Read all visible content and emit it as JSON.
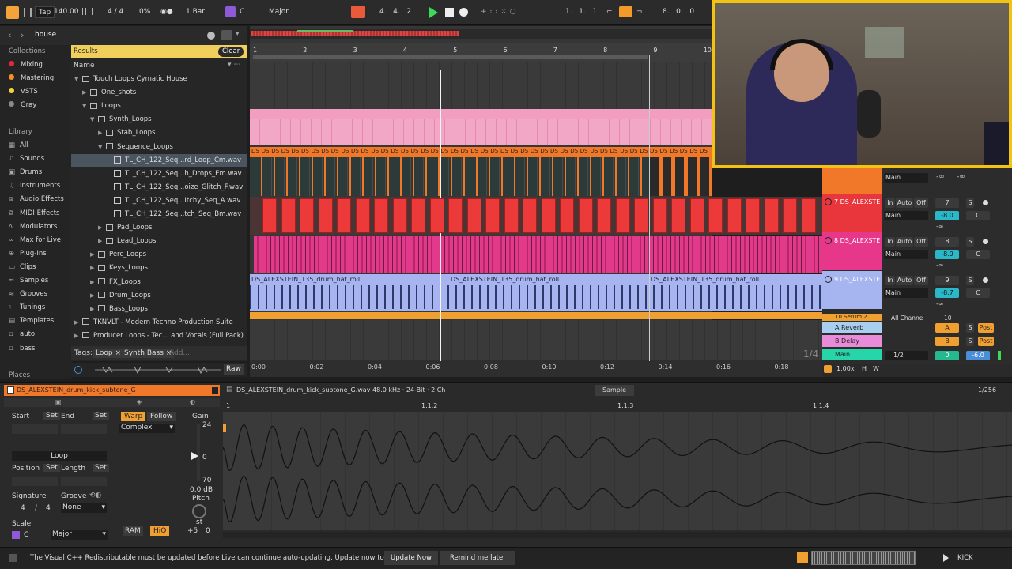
{
  "topbar": {
    "tap": "Tap",
    "tempo": "140.00",
    "meter": "4 / 4",
    "swing": "0%",
    "quantize": "1 Bar",
    "key": "C",
    "scale": "Major",
    "position": "4.   4.   2",
    "loop_start": "1.   1.   1",
    "loop_length": "8.   0.   0"
  },
  "browser": {
    "search_value": "house",
    "results_label": "Results",
    "clear_label": "Clear",
    "name_header": "Name",
    "collections_label": "Collections",
    "collections": [
      {
        "label": "Mixing",
        "color": "#e3283b"
      },
      {
        "label": "Mastering",
        "color": "#f3902a"
      },
      {
        "label": "VSTS",
        "color": "#f3d23a"
      },
      {
        "label": "Gray",
        "color": "#8a8a8a"
      }
    ],
    "library_label": "Library",
    "library": [
      "All",
      "Sounds",
      "Drums",
      "Instruments",
      "Audio Effects",
      "MIDI Effects",
      "Modulators",
      "Max for Live",
      "Plug-Ins",
      "Clips",
      "Samples",
      "Grooves",
      "Tunings",
      "Templates",
      "auto",
      "bass"
    ],
    "places_label": "Places",
    "tree": [
      {
        "label": "Touch Loops Cymatic House",
        "indent": 0,
        "type": "folder",
        "open": true
      },
      {
        "label": "One_shots",
        "indent": 1,
        "type": "folder",
        "open": false
      },
      {
        "label": "Loops",
        "indent": 1,
        "type": "folder",
        "open": true
      },
      {
        "label": "Synth_Loops",
        "indent": 2,
        "type": "folder",
        "open": true
      },
      {
        "label": "Stab_Loops",
        "indent": 3,
        "type": "folder",
        "open": false
      },
      {
        "label": "Sequence_Loops",
        "indent": 3,
        "type": "folder",
        "open": true
      },
      {
        "label": "TL_CH_122_Seq...rd_Loop_Cm.wav",
        "indent": 4,
        "type": "file",
        "selected": true
      },
      {
        "label": "TL_CH_122_Seq...h_Drops_Em.wav",
        "indent": 4,
        "type": "file"
      },
      {
        "label": "TL_CH_122_Seq...oize_Glitch_F.wav",
        "indent": 4,
        "type": "file"
      },
      {
        "label": "TL_CH_122_Seq...Itchy_Seq_A.wav",
        "indent": 4,
        "type": "file"
      },
      {
        "label": "TL_CH_122_Seq...tch_Seq_Bm.wav",
        "indent": 4,
        "type": "file"
      },
      {
        "label": "Pad_Loops",
        "indent": 3,
        "type": "folder",
        "open": false
      },
      {
        "label": "Lead_Loops",
        "indent": 3,
        "type": "folder",
        "open": false
      },
      {
        "label": "Perc_Loops",
        "indent": 2,
        "type": "folder",
        "open": false
      },
      {
        "label": "Keys_Loops",
        "indent": 2,
        "type": "folder",
        "open": false
      },
      {
        "label": "FX_Loops",
        "indent": 2,
        "type": "folder",
        "open": false
      },
      {
        "label": "Drum_Loops",
        "indent": 2,
        "type": "folder",
        "open": false
      },
      {
        "label": "Bass_Loops",
        "indent": 2,
        "type": "folder",
        "open": false
      },
      {
        "label": "TKNVLT - Modern Techno Production Suite",
        "indent": 0,
        "type": "folder",
        "open": false
      },
      {
        "label": "Producer Loops - Tec... and Vocals (Full Pack)",
        "indent": 0,
        "type": "folder",
        "open": false
      }
    ],
    "tags_label": "Tags:",
    "tags": [
      "Loop",
      "Synth Bass"
    ],
    "tags_add": "Add...",
    "raw_label": "Raw"
  },
  "arrangement": {
    "bars": [
      "1",
      "2",
      "3",
      "4",
      "5",
      "6",
      "7",
      "8",
      "9",
      "10"
    ],
    "times": [
      "0:00",
      "0:02",
      "0:04",
      "0:06",
      "0:08",
      "0:10",
      "0:12",
      "0:14",
      "0:16",
      "0:18"
    ],
    "zoom_label": "1/4",
    "clip_label_ds": "DS",
    "hat_clip_label": "DS_ALEXSTEIN_135_drum_hat_roll"
  },
  "mixer": {
    "tracks": [
      {
        "name": "7 DS_ALEXSTE",
        "color": "#e8363c",
        "num": "7",
        "vol": "-8.0",
        "pan": "C",
        "out": "Main"
      },
      {
        "name": "8 DS_ALEXSTE",
        "color": "#e6378a",
        "num": "8",
        "vol": "-8.9",
        "pan": "C",
        "out": "Main"
      },
      {
        "name": "9 DS_ALEXSTE",
        "color": "#a6b4f0",
        "num": "9",
        "vol": "-8.7",
        "pan": "C",
        "out": "Main"
      }
    ],
    "top_out": "Main",
    "inf": "-∞",
    "in_label": "In",
    "auto_label": "Auto",
    "off_label": "Off",
    "serum_label": "10 Serum 2",
    "serum_num": "10",
    "all_channels": "All Channe",
    "return_a": "A Reverb",
    "return_b": "B Delay",
    "main_label": "Main",
    "a_btn": "A",
    "b_btn": "B",
    "post_label": "Post",
    "main_sel": "1/2",
    "main_send": "0",
    "main_vol": "-6.0",
    "zoom_val": "1.00x",
    "h_label": "H",
    "w_label": "W",
    "s_label": "S"
  },
  "clip": {
    "name": "DS_ALEXSTEIN_drum_kick_subtone_G",
    "file_info": "DS_ALEXSTEIN_drum_kick_subtone_G.wav 48.0 kHz · 24-Bit · 2 Ch",
    "sample_tab": "Sample",
    "page": "1/256",
    "start_label": "Start",
    "end_label": "End",
    "set_label": "Set",
    "loop_label": "Loop",
    "position_label": "Position",
    "length_label": "Length",
    "signature_label": "Signature",
    "groove_label": "Groove",
    "sig_num": "4",
    "sig_den": "4",
    "groove_value": "None",
    "scale_label": "Scale",
    "scale_key": "C",
    "scale_mode": "Major",
    "warp_label": "Warp",
    "follow_label": "Follow",
    "warp_mode": "Complex",
    "gain_label": "Gain",
    "gain_top": "24",
    "gain_zero": "0",
    "gain_bottom": "70",
    "gain_value": "0.0 dB",
    "pitch_label": "Pitch",
    "st_label": "st",
    "transpose": "+5",
    "detune": "0",
    "ram_label": "RAM",
    "hiq_label": "HiQ",
    "ruler": [
      "1",
      "1.1.2",
      "1.1.3",
      "1.1.4"
    ]
  },
  "status": {
    "message": "The Visual C++ Redistributable must be updated before Live can continue auto-updating. Update now to proceed.",
    "update_now": "Update Now",
    "remind": "Remind me later",
    "track_label": "KICK"
  }
}
